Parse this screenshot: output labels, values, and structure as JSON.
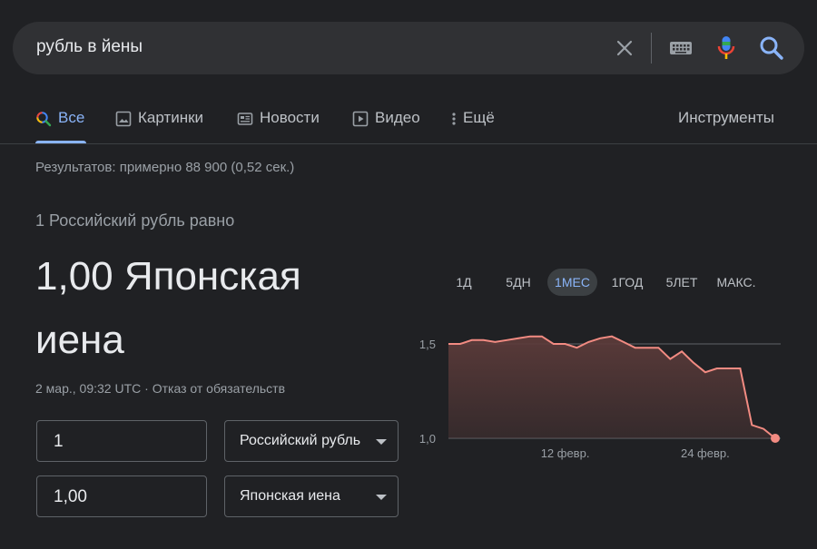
{
  "search": {
    "query": "рубль в йены"
  },
  "tabs": [
    {
      "label": "Все",
      "icon": "search-icon",
      "active": true
    },
    {
      "label": "Картинки",
      "icon": "image-icon"
    },
    {
      "label": "Новости",
      "icon": "news-icon"
    },
    {
      "label": "Видео",
      "icon": "video-icon"
    },
    {
      "label": "Ещё",
      "icon": "more-vert-icon"
    }
  ],
  "tools_label": "Инструменты",
  "stats": "Результатов: примерно 88 900 (0,52 сек.)",
  "converter": {
    "equals_text": "1 Российский рубль равно",
    "result_line1": "1,00 Японская",
    "result_line2": "иена",
    "datetime": "2 мар., 09:32 UTC",
    "separator": " · ",
    "disclaimer": "Отказ от обязательств",
    "from_amount": "1",
    "from_currency": "Российский рубль",
    "to_amount": "1,00",
    "to_currency": "Японская иена"
  },
  "ranges": [
    {
      "label": "1Д"
    },
    {
      "label": "5ДН"
    },
    {
      "label": "1МЕС",
      "active": true
    },
    {
      "label": "1ГОД"
    },
    {
      "label": "5ЛЕТ"
    },
    {
      "label": "МАКС."
    }
  ],
  "colors": {
    "line": "#f28b82",
    "fill": "#5c3b3a",
    "accent": "#8ab4f8",
    "grid": "#5f6368"
  },
  "chart_data": {
    "type": "area",
    "x": [
      "2 фев",
      "3 фев",
      "4 фев",
      "5 фев",
      "6 фев",
      "7 фев",
      "8 фев",
      "9 фев",
      "10 фев",
      "11 фев",
      "12 фев",
      "13 фев",
      "14 фев",
      "15 фев",
      "16 фев",
      "17 фев",
      "18 фев",
      "19 фев",
      "20 фев",
      "21 фев",
      "22 фев",
      "23 фев",
      "24 фев",
      "25 фев",
      "26 фев",
      "27 фев",
      "28 фев",
      "1 мар",
      "2 мар"
    ],
    "y": [
      1.5,
      1.5,
      1.52,
      1.52,
      1.51,
      1.52,
      1.53,
      1.54,
      1.54,
      1.5,
      1.5,
      1.48,
      1.51,
      1.53,
      1.54,
      1.51,
      1.48,
      1.48,
      1.48,
      1.42,
      1.46,
      1.4,
      1.35,
      1.37,
      1.37,
      1.37,
      1.07,
      1.05,
      1.0
    ],
    "yticks": [
      "1,5",
      "1,0"
    ],
    "ytick_values": [
      1.5,
      1.0
    ],
    "xticks": [
      "12 февр.",
      "24 февр."
    ],
    "xtick_indices": [
      10,
      22
    ],
    "ylim": [
      0.95,
      1.62
    ],
    "grid": true
  }
}
